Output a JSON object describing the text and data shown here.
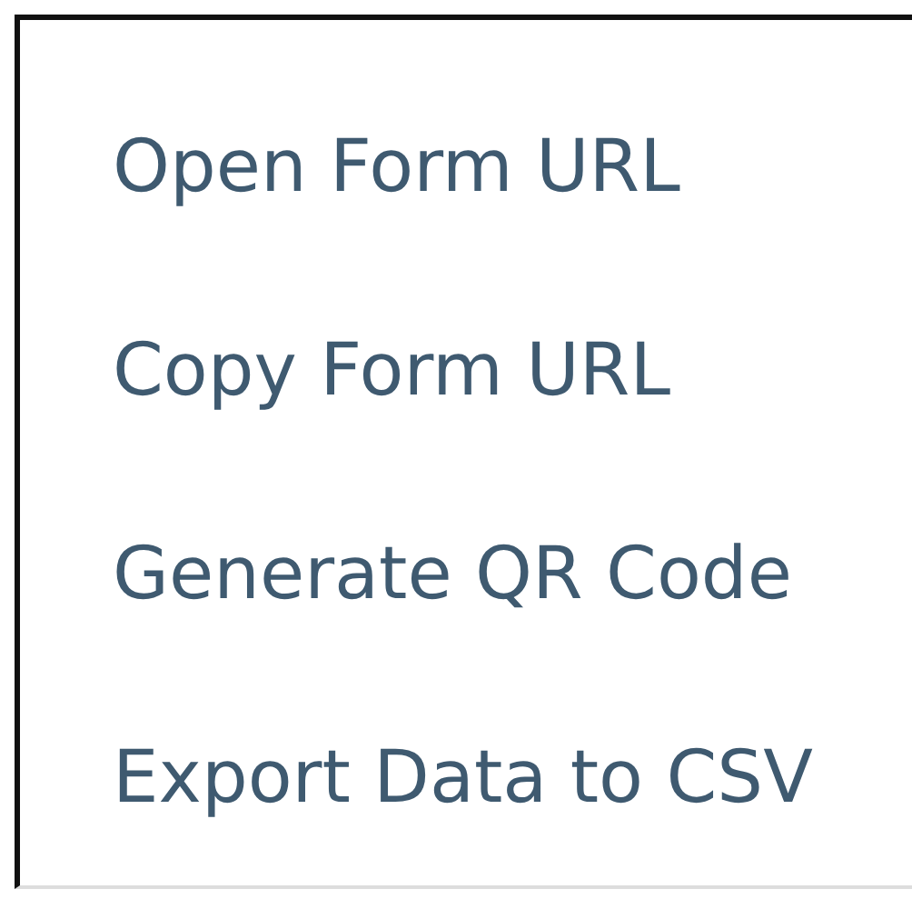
{
  "menu": {
    "items": [
      {
        "label": "Open Form URL"
      },
      {
        "label": "Copy Form URL"
      },
      {
        "label": "Generate QR Code"
      },
      {
        "label": "Export Data to CSV"
      }
    ]
  }
}
